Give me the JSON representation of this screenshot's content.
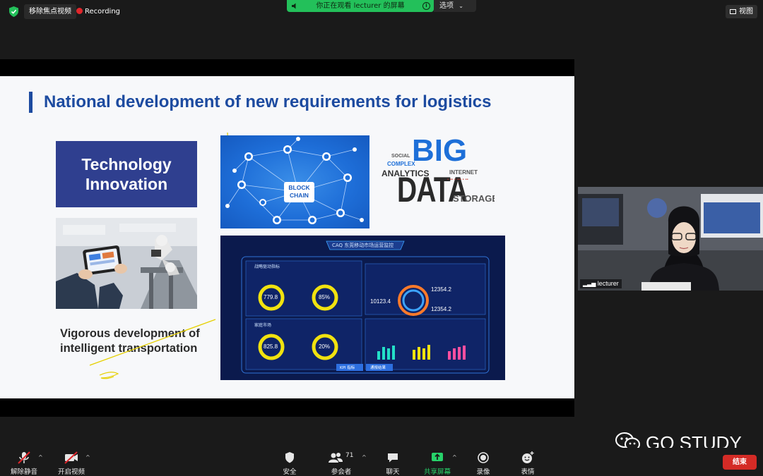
{
  "topbar": {
    "unfocus_label": "移除焦点视频",
    "recording_label": "Recording",
    "share_banner_text": "你正在观看 lecturer 的屏幕",
    "options_label": "选项",
    "view_label": "视图"
  },
  "slide": {
    "title": "National development of new requirements for logistics",
    "tech_box_line1": "Technology",
    "tech_box_line2": "Innovation",
    "vigorous_line1": "Vigorous development of",
    "vigorous_line2": "intelligent transportation",
    "blockchain_line1": "BLOCK",
    "blockchain_line2": "CHAIN",
    "bigdata_big": "BIG",
    "bigdata_data": "DATA",
    "bigdata_words": [
      "ANALYTICS",
      "STORAGE",
      "COMPLEX",
      "INTERNET",
      "SOCIAL"
    ],
    "dashboard": {
      "title": "CAQ 东莞移动市场运营监控",
      "section_main": "战略驱动指标",
      "section_market": "家庭市场",
      "val_1": "779.8",
      "pct_1": "85%",
      "val_2": "825.8",
      "pct_2": "20%",
      "num_1": "12354.2",
      "num_2": "10123.4",
      "num_3": "12354.2",
      "btn_1": "KPI 指标",
      "btn_2": "通报结果"
    }
  },
  "webcam": {
    "name": "lecturer"
  },
  "watermark": {
    "text": "GO STUDY"
  },
  "toolbar": {
    "unmute": "解除静音",
    "start_video": "开启视频",
    "security": "安全",
    "participants": "参会者",
    "participants_count": "71",
    "chat": "聊天",
    "share_screen": "共享屏幕",
    "record": "录像",
    "reactions": "表情",
    "end": "结束"
  },
  "colors": {
    "slide_title": "#1d4ba0",
    "tech_box": "#2f3f8f",
    "share_banner": "#23c05a",
    "end_button": "#d42b26",
    "recording_dot": "#e0262b"
  }
}
